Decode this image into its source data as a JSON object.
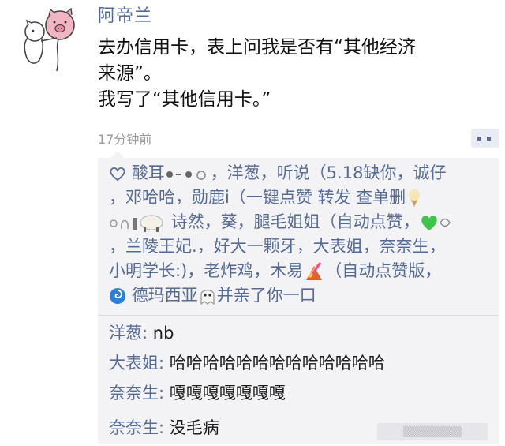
{
  "post": {
    "username": "阿帝兰",
    "text_lines": [
      "去办信用卡，表上问我是否有“其他经济",
      "来源”。",
      " 我写了“其他信用卡。”"
    ],
    "timestamp": "17分钟前"
  },
  "likes": {
    "heart_icon": "heart-outline-icon",
    "lines": {
      "l1a": "酸耳",
      "l1b": "，洋葱，听说（5.18缺你，诚仔",
      "l2a": "，邓哈哈，勋鹿i（一键点赞 转发 查单删",
      "l3a": "诗然，葵，腿毛姐姐（自动点赞，",
      "l4": "，兰陵王妃.，好大一颗牙，大表姐，奈奈生，",
      "l5": "小明学长:)，老炸鸡，木易",
      "l5b": "（自动点赞版，",
      "l6a": "德玛西亚",
      "l6b": "并亲了你一口"
    }
  },
  "comments": [
    {
      "name": "洋葱:",
      "text": " nb"
    },
    {
      "name": "大表姐:",
      "text": " 哈哈哈哈哈哈哈哈哈哈哈哈哈"
    },
    {
      "name": "奈奈生:",
      "text": " 嘎嘎嘎嘎嘎嘎嘎"
    },
    {
      "name": "奈奈生:",
      "text": " 没毛病"
    }
  ],
  "colors": {
    "name_blue": "#566b94",
    "comment_bg": "#f3f3f5",
    "timestamp_gray": "#9a9a9a"
  },
  "watermark": "▒▒▒▒▒▒▒▒"
}
